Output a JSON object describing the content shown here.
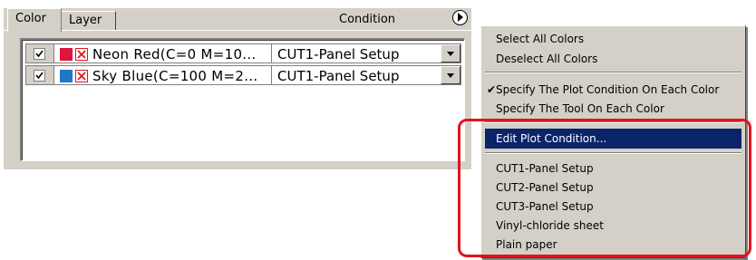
{
  "tabs": {
    "color": "Color",
    "layer": "Layer"
  },
  "header": {
    "condition": "Condition"
  },
  "rows": [
    {
      "checked": true,
      "swatch_color": "#e0143c",
      "name": "Neon Red(C=0 M=10...",
      "condition": "CUT1-Panel Setup"
    },
    {
      "checked": true,
      "swatch_color": "#1e78c8",
      "name": "Sky Blue(C=100 M=2...",
      "condition": "CUT1-Panel Setup"
    }
  ],
  "menu": {
    "items": [
      {
        "label": "Select All Colors",
        "checked": false,
        "highlighted": false
      },
      {
        "label": "Deselect All Colors",
        "checked": false,
        "highlighted": false
      },
      {
        "label": "Specify The Plot Condition On Each Color",
        "checked": true,
        "highlighted": false
      },
      {
        "label": "Specify The Tool On Each Color",
        "checked": false,
        "highlighted": false
      },
      {
        "label": "Edit Plot Condition...",
        "checked": false,
        "highlighted": true
      },
      {
        "label": "CUT1-Panel Setup",
        "checked": false,
        "highlighted": false
      },
      {
        "label": "CUT2-Panel Setup",
        "checked": false,
        "highlighted": false
      },
      {
        "label": "CUT3-Panel Setup",
        "checked": false,
        "highlighted": false
      },
      {
        "label": "Vinyl-chloride sheet",
        "checked": false,
        "highlighted": false
      },
      {
        "label": "Plain paper",
        "checked": false,
        "highlighted": false
      }
    ],
    "check_glyph": "✔"
  },
  "colors": {
    "panel_bg": "#d4d0c8",
    "highlight": "#0a246a",
    "callout_red": "#e0141e"
  },
  "icons": [
    "menu-arrow-icon",
    "checkbox-check-icon",
    "x-box-icon",
    "dropdown-arrow-icon",
    "checkmark-icon"
  ]
}
